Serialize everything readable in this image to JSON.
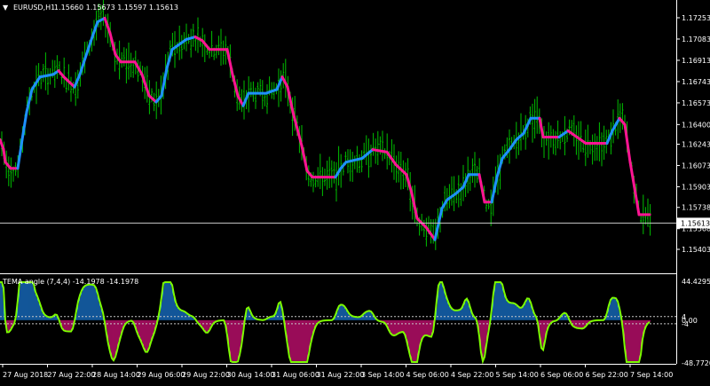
{
  "header": {
    "menu_glyph": "▼",
    "symbol": "EURUSD,H1",
    "ohlc": "1.15660 1.15673 1.15597 1.15613"
  },
  "main_axis": [
    {
      "price": 1.17253,
      "label": "1.17253"
    },
    {
      "price": 1.17083,
      "label": "1.17083"
    },
    {
      "price": 1.16913,
      "label": "1.16913"
    },
    {
      "price": 1.16743,
      "label": "1.16743"
    },
    {
      "price": 1.16573,
      "label": "1.16573"
    },
    {
      "price": 1.164,
      "label": "1.16400"
    },
    {
      "price": 1.16243,
      "label": "1.16243"
    },
    {
      "price": 1.16073,
      "label": "1.16073"
    },
    {
      "price": 1.15903,
      "label": "1.15903"
    },
    {
      "price": 1.15738,
      "label": "1.15738"
    },
    {
      "price": 1.15568,
      "label": "1.15568"
    },
    {
      "price": 1.15403,
      "label": "1.15403"
    }
  ],
  "current_price": {
    "price": 1.15613,
    "label": "1.15613"
  },
  "indicator": {
    "title": "TEMA angle (7,4,4) -14.1978 -14.1978",
    "axis": [
      {
        "value": 44.4295,
        "label": "44.4295"
      },
      {
        "value": 4,
        "label": "4"
      },
      {
        "value": 0,
        "label": "0.00"
      },
      {
        "value": -4,
        "label": "-4"
      },
      {
        "value": -48.772,
        "label": "-48.7720"
      }
    ]
  },
  "time_axis": [
    "27 Aug 2018",
    "27 Aug 22:00",
    "28 Aug 14:00",
    "29 Aug 06:00",
    "29 Aug 22:00",
    "30 Aug 14:00",
    "31 Aug 06:00",
    "31 Aug 22:00",
    "3 Sep 14:00",
    "4 Sep 06:00",
    "4 Sep 22:00",
    "5 Sep 14:00",
    "6 Sep 06:00",
    "6 Sep 22:00",
    "7 Sep 14:00"
  ],
  "colors": {
    "up": "#1e90ff",
    "down": "#ff1493",
    "bars": "#00c000",
    "indicator_line": "#7cfc00",
    "frame": "#ffffff",
    "level": "#c8c8c8"
  },
  "chart_data": {
    "type": "line",
    "ylim": [
      1.1538,
      1.1734
    ],
    "tema_points": [
      [
        0,
        1.1628
      ],
      [
        4,
        1.162
      ],
      [
        6,
        1.161
      ],
      [
        12,
        1.1605
      ],
      [
        20,
        1.1605
      ],
      [
        25,
        1.1628
      ],
      [
        30,
        1.165
      ],
      [
        36,
        1.1668
      ],
      [
        45,
        1.1678
      ],
      [
        60,
        1.168
      ],
      [
        66,
        1.1683
      ],
      [
        72,
        1.1678
      ],
      [
        84,
        1.167
      ],
      [
        90,
        1.168
      ],
      [
        96,
        1.1693
      ],
      [
        104,
        1.171
      ],
      [
        110,
        1.1722
      ],
      [
        118,
        1.1725
      ],
      [
        124,
        1.1713
      ],
      [
        130,
        1.1696
      ],
      [
        136,
        1.169
      ],
      [
        152,
        1.169
      ],
      [
        160,
        1.168
      ],
      [
        168,
        1.1663
      ],
      [
        176,
        1.1658
      ],
      [
        182,
        1.1663
      ],
      [
        188,
        1.1685
      ],
      [
        194,
        1.17
      ],
      [
        200,
        1.1703
      ],
      [
        210,
        1.1708
      ],
      [
        220,
        1.171
      ],
      [
        228,
        1.1707
      ],
      [
        236,
        1.17
      ],
      [
        256,
        1.17
      ],
      [
        262,
        1.168
      ],
      [
        268,
        1.1663
      ],
      [
        274,
        1.1655
      ],
      [
        280,
        1.1665
      ],
      [
        300,
        1.1665
      ],
      [
        312,
        1.1668
      ],
      [
        318,
        1.1678
      ],
      [
        324,
        1.167
      ],
      [
        330,
        1.165
      ],
      [
        340,
        1.1623
      ],
      [
        346,
        1.1603
      ],
      [
        352,
        1.1598
      ],
      [
        378,
        1.1598
      ],
      [
        384,
        1.1605
      ],
      [
        390,
        1.161
      ],
      [
        408,
        1.1613
      ],
      [
        420,
        1.162
      ],
      [
        436,
        1.1618
      ],
      [
        446,
        1.1608
      ],
      [
        458,
        1.16
      ],
      [
        464,
        1.1585
      ],
      [
        470,
        1.1565
      ],
      [
        480,
        1.1558
      ],
      [
        490,
        1.1548
      ],
      [
        498,
        1.1573
      ],
      [
        504,
        1.158
      ],
      [
        514,
        1.1585
      ],
      [
        522,
        1.159
      ],
      [
        528,
        1.16
      ],
      [
        540,
        1.16
      ],
      [
        546,
        1.1578
      ],
      [
        554,
        1.1578
      ],
      [
        560,
        1.1598
      ],
      [
        566,
        1.1613
      ],
      [
        574,
        1.162
      ],
      [
        582,
        1.1628
      ],
      [
        590,
        1.1633
      ],
      [
        598,
        1.1645
      ],
      [
        608,
        1.1645
      ],
      [
        612,
        1.163
      ],
      [
        630,
        1.163
      ],
      [
        640,
        1.1635
      ],
      [
        650,
        1.163
      ],
      [
        660,
        1.1625
      ],
      [
        684,
        1.1625
      ],
      [
        690,
        1.1635
      ],
      [
        698,
        1.1645
      ],
      [
        704,
        1.164
      ],
      [
        710,
        1.161
      ],
      [
        716,
        1.1585
      ],
      [
        720,
        1.1568
      ],
      [
        732,
        1.1568
      ]
    ]
  }
}
